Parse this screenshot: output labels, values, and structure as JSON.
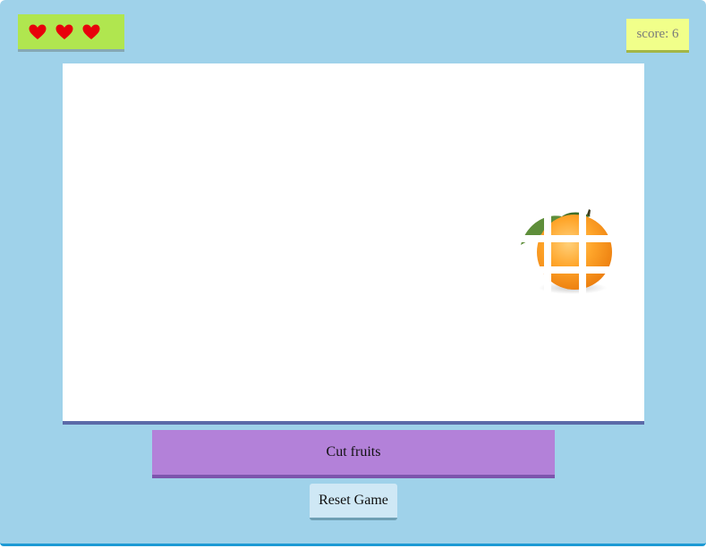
{
  "hud": {
    "lives": 3,
    "score_label": "score:",
    "score_value": "6"
  },
  "game": {
    "fruit": "orange",
    "fruit_state": "sliced"
  },
  "controls": {
    "action_label": "Cut fruits",
    "reset_label": "Reset Game"
  },
  "colors": {
    "background": "#9fd2ea",
    "lives_panel": "#b0e64f",
    "score_panel": "#f1ff8a",
    "action_button": "#b381d9",
    "reset_button": "#cfe8f5",
    "heart": "#e8000b"
  },
  "icons": {
    "life": "heart-icon"
  }
}
